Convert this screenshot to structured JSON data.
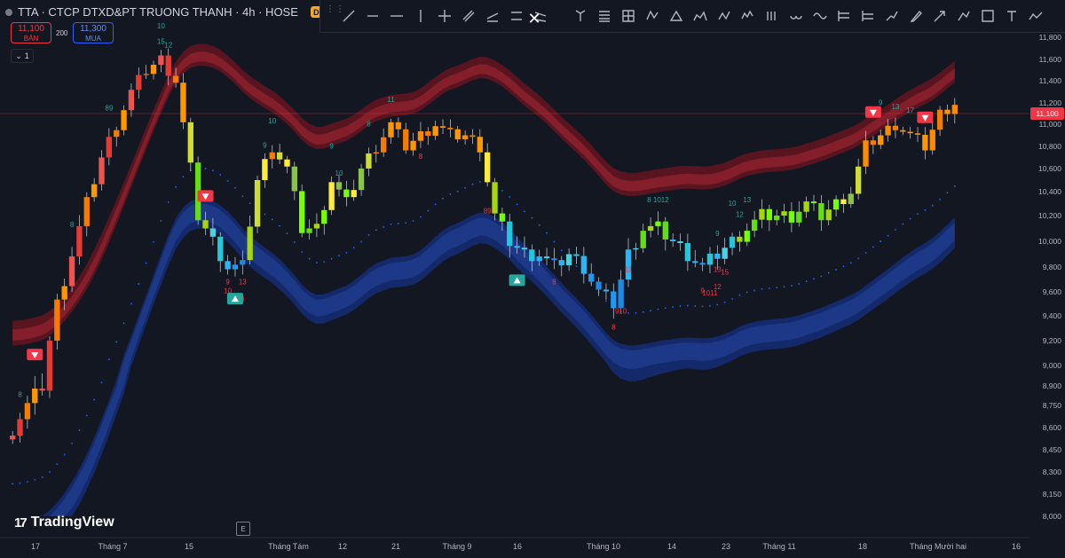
{
  "header": {
    "symbol": "TTA",
    "company": "CTCP DTXD&PT TRUONG THANH",
    "timeframe": "4h",
    "exchange": "HOSE",
    "title_text": "TTA · CTCP DTXD&PT TRUONG THANH · 4h · HOSE",
    "data_badge": "D"
  },
  "trade": {
    "sell_price": "11,100",
    "sell_label": "BÁN",
    "spread": "200",
    "buy_price": "11,300",
    "buy_label": "MUA",
    "indicator_count": "1"
  },
  "toolbar": {
    "close_label": "✕",
    "tools": [
      "trend-line-icon",
      "horizontal-ray-icon",
      "horizontal-line-icon",
      "vertical-line-icon",
      "cross-line-icon",
      "parallel-channel-icon",
      "regression-icon",
      "flat-top-icon",
      "disjoint-channel-icon",
      "pitchfork-icon",
      "fib-retracement-icon",
      "gann-box-icon",
      "xabcd-pattern-icon",
      "triangle-pattern-icon",
      "head-shoulders-icon",
      "abcd-pattern-icon",
      "elliott-wave-icon",
      "cycle-lines-icon",
      "time-cycles-icon",
      "sine-line-icon",
      "long-position-icon",
      "short-position-icon",
      "forecast-icon",
      "brush-icon",
      "arrow-icon",
      "path-icon",
      "rectangle-icon",
      "text-icon",
      "polyline-icon"
    ]
  },
  "branding": {
    "logo_text": "TradingView",
    "e_label": "E"
  },
  "current_price_label": "11,100",
  "colors": {
    "background": "#131722",
    "upper_band": "#8a1f2b",
    "lower_band": "#1e3a8a",
    "signal_up": "#26a69a",
    "signal_down": "#f23645",
    "trail_dots": "#2962ff"
  },
  "chart_data": {
    "type": "candlestick",
    "y_axis_ticks": [
      "11,800",
      "11,600",
      "11,400",
      "11,200",
      "11,000",
      "10,800",
      "10,600",
      "10,400",
      "10,200",
      "10,000",
      "9,800",
      "9,600",
      "9,400",
      "9,200",
      "9,000",
      "8,900",
      "8,750",
      "8,600",
      "8,450",
      "8,300",
      "8,150",
      "8,000"
    ],
    "y_axis_tick_values": [
      11800,
      11600,
      11400,
      11200,
      11000,
      10800,
      10600,
      10400,
      10200,
      10000,
      9800,
      9600,
      9400,
      9200,
      9000,
      8900,
      8750,
      8600,
      8450,
      8300,
      8150,
      8000
    ],
    "x_axis_labels": [
      "17",
      "Tháng 7",
      "15",
      "Tháng Tám",
      "12",
      "21",
      "Tháng 9",
      "16",
      "Tháng 10",
      "14",
      "23",
      "Tháng 11",
      "18",
      "Tháng Mười hai",
      "16"
    ],
    "close_path": [
      [
        0,
        8600
      ],
      [
        2,
        8750
      ],
      [
        4,
        8900
      ],
      [
        6,
        9500
      ],
      [
        8,
        9900
      ],
      [
        10,
        10300
      ],
      [
        12,
        10700
      ],
      [
        14,
        11000
      ],
      [
        16,
        11300
      ],
      [
        18,
        11500
      ],
      [
        20,
        11600
      ],
      [
        22,
        11400
      ],
      [
        24,
        10600
      ],
      [
        25,
        10200
      ],
      [
        27,
        10000
      ],
      [
        29,
        9800
      ],
      [
        31,
        9800
      ],
      [
        33,
        10500
      ],
      [
        35,
        10800
      ],
      [
        37,
        10600
      ],
      [
        39,
        10100
      ],
      [
        41,
        10100
      ],
      [
        43,
        10500
      ],
      [
        45,
        10300
      ],
      [
        47,
        10600
      ],
      [
        49,
        10800
      ],
      [
        51,
        11000
      ],
      [
        53,
        10800
      ],
      [
        55,
        10900
      ],
      [
        57,
        11000
      ],
      [
        59,
        10900
      ],
      [
        61,
        10900
      ],
      [
        63,
        10800
      ],
      [
        65,
        10200
      ],
      [
        67,
        10000
      ],
      [
        69,
        9900
      ],
      [
        71,
        9900
      ],
      [
        73,
        9800
      ],
      [
        75,
        9900
      ],
      [
        77,
        9800
      ],
      [
        79,
        9600
      ],
      [
        81,
        9500
      ],
      [
        83,
        9900
      ],
      [
        85,
        10100
      ],
      [
        87,
        10100
      ],
      [
        89,
        10000
      ],
      [
        91,
        9900
      ],
      [
        93,
        9800
      ],
      [
        95,
        9900
      ],
      [
        97,
        10000
      ],
      [
        99,
        10100
      ],
      [
        101,
        10200
      ],
      [
        103,
        10200
      ],
      [
        105,
        10200
      ],
      [
        107,
        10300
      ],
      [
        109,
        10200
      ],
      [
        111,
        10300
      ],
      [
        113,
        10400
      ],
      [
        115,
        10800
      ],
      [
        117,
        10900
      ],
      [
        119,
        11000
      ],
      [
        121,
        10900
      ],
      [
        123,
        10800
      ],
      [
        125,
        11100
      ],
      [
        127,
        11200
      ]
    ],
    "signal_labels": {
      "green": [
        {
          "text": "8",
          "bar": 1
        },
        {
          "text": "8",
          "bar": 8
        },
        {
          "text": "89",
          "bar": 13
        },
        {
          "text": "15",
          "bar": 20
        },
        {
          "text": "12",
          "bar": 21
        },
        {
          "text": "10",
          "bar": 20
        },
        {
          "text": "9",
          "bar": 34
        },
        {
          "text": "10",
          "bar": 35
        },
        {
          "text": "9",
          "bar": 43
        },
        {
          "text": "10",
          "bar": 44
        },
        {
          "text": "11",
          "bar": 51
        },
        {
          "text": "8",
          "bar": 48
        },
        {
          "text": "9",
          "bar": 95
        },
        {
          "text": "8 1012",
          "bar": 87
        },
        {
          "text": "10",
          "bar": 97
        },
        {
          "text": "12",
          "bar": 98
        },
        {
          "text": "13",
          "bar": 99
        },
        {
          "text": "9",
          "bar": 117
        },
        {
          "text": "13",
          "bar": 119
        },
        {
          "text": "17",
          "bar": 121
        }
      ],
      "red": [
        {
          "text": "9",
          "bar": 29
        },
        {
          "text": "10",
          "bar": 29
        },
        {
          "text": "8",
          "bar": 31
        },
        {
          "text": "13",
          "bar": 31
        },
        {
          "text": "8",
          "bar": 55
        },
        {
          "text": "89",
          "bar": 64
        },
        {
          "text": "8",
          "bar": 73
        },
        {
          "text": "8",
          "bar": 81
        },
        {
          "text": "910",
          "bar": 82
        },
        {
          "text": "11",
          "bar": 83
        },
        {
          "text": "9",
          "bar": 93
        },
        {
          "text": "1011",
          "bar": 94
        },
        {
          "text": "13",
          "bar": 95
        },
        {
          "text": "15",
          "bar": 96
        },
        {
          "text": "12",
          "bar": 95
        }
      ]
    },
    "buy_signals": [
      {
        "bar": 30
      },
      {
        "bar": 68
      }
    ],
    "sell_signals": [
      {
        "bar": 3
      },
      {
        "bar": 26
      },
      {
        "bar": 116
      },
      {
        "bar": 123
      }
    ]
  }
}
